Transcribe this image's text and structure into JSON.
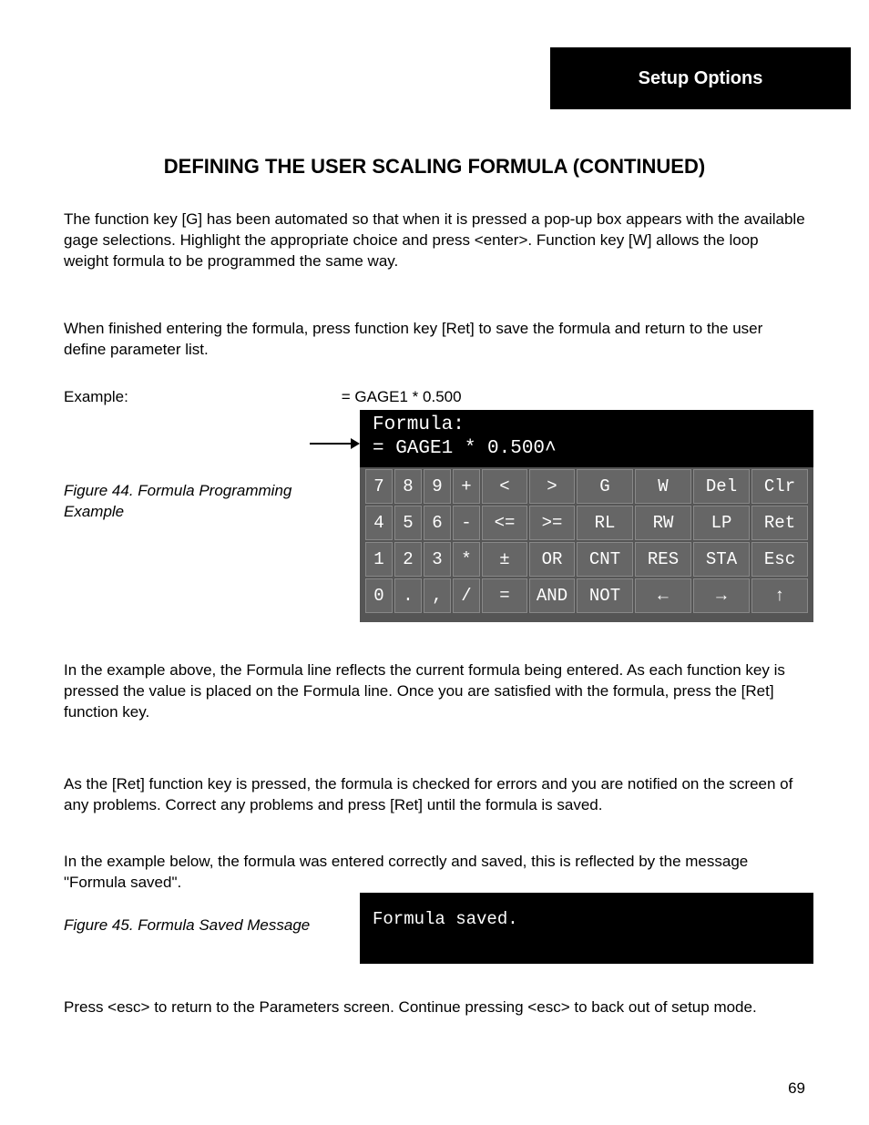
{
  "header_tab": "Setup Options",
  "title": "DEFINING THE USER SCALING FORMULA (CONTINUED)",
  "para1": "The function key [G] has been automated so that when it is pressed a pop-up box appears with the available gage selections. Highlight the appropriate choice and press <enter>. Function key [W] allows the loop weight formula to be programmed the same way.",
  "para2": "When finished entering the formula, press function key [Ret] to save the formula and return to the user define parameter list.",
  "example_label": "Example:",
  "example_text": "= GAGE1 * 0.500",
  "fig1_caption": "Figure 44. Formula Programming Example",
  "formula_header_label": "Formula:",
  "formula_header_value": "= GAGE1 * 0.500",
  "cursor_glyph": "˄",
  "keypad": [
    [
      "7",
      "8",
      "9",
      "+",
      "<",
      ">",
      "G",
      "W",
      "Del",
      "Clr"
    ],
    [
      "4",
      "5",
      "6",
      "-",
      "<=",
      ">=",
      "RL",
      "RW",
      "LP",
      "Ret"
    ],
    [
      "1",
      "2",
      "3",
      "*",
      "±",
      "OR",
      "CNT",
      "RES",
      "STA",
      "Esc"
    ],
    [
      "0",
      ".",
      ",",
      "/",
      "=",
      "AND",
      "NOT",
      "←",
      "→",
      "↑"
    ]
  ],
  "para4": "In the example above, the Formula line reflects the current formula being entered. As each function key is pressed the value is placed on the Formula line. Once you are satisfied with the formula, press the [Ret] function key.",
  "para5": "As the [Ret] function key is pressed, the formula is checked for errors and you are notified on the screen of any problems. Correct any problems and press [Ret] until the formula is saved.",
  "para6": "In the example below, the formula was entered correctly and saved, this is reflected by the message \"Formula saved\".",
  "fig2_caption": "Figure 45. Formula Saved Message",
  "formula_saved": "Formula saved.",
  "para7": "Press <esc> to return to the Parameters screen. Continue pressing <esc> to back out of setup mode.",
  "page_number": "69"
}
